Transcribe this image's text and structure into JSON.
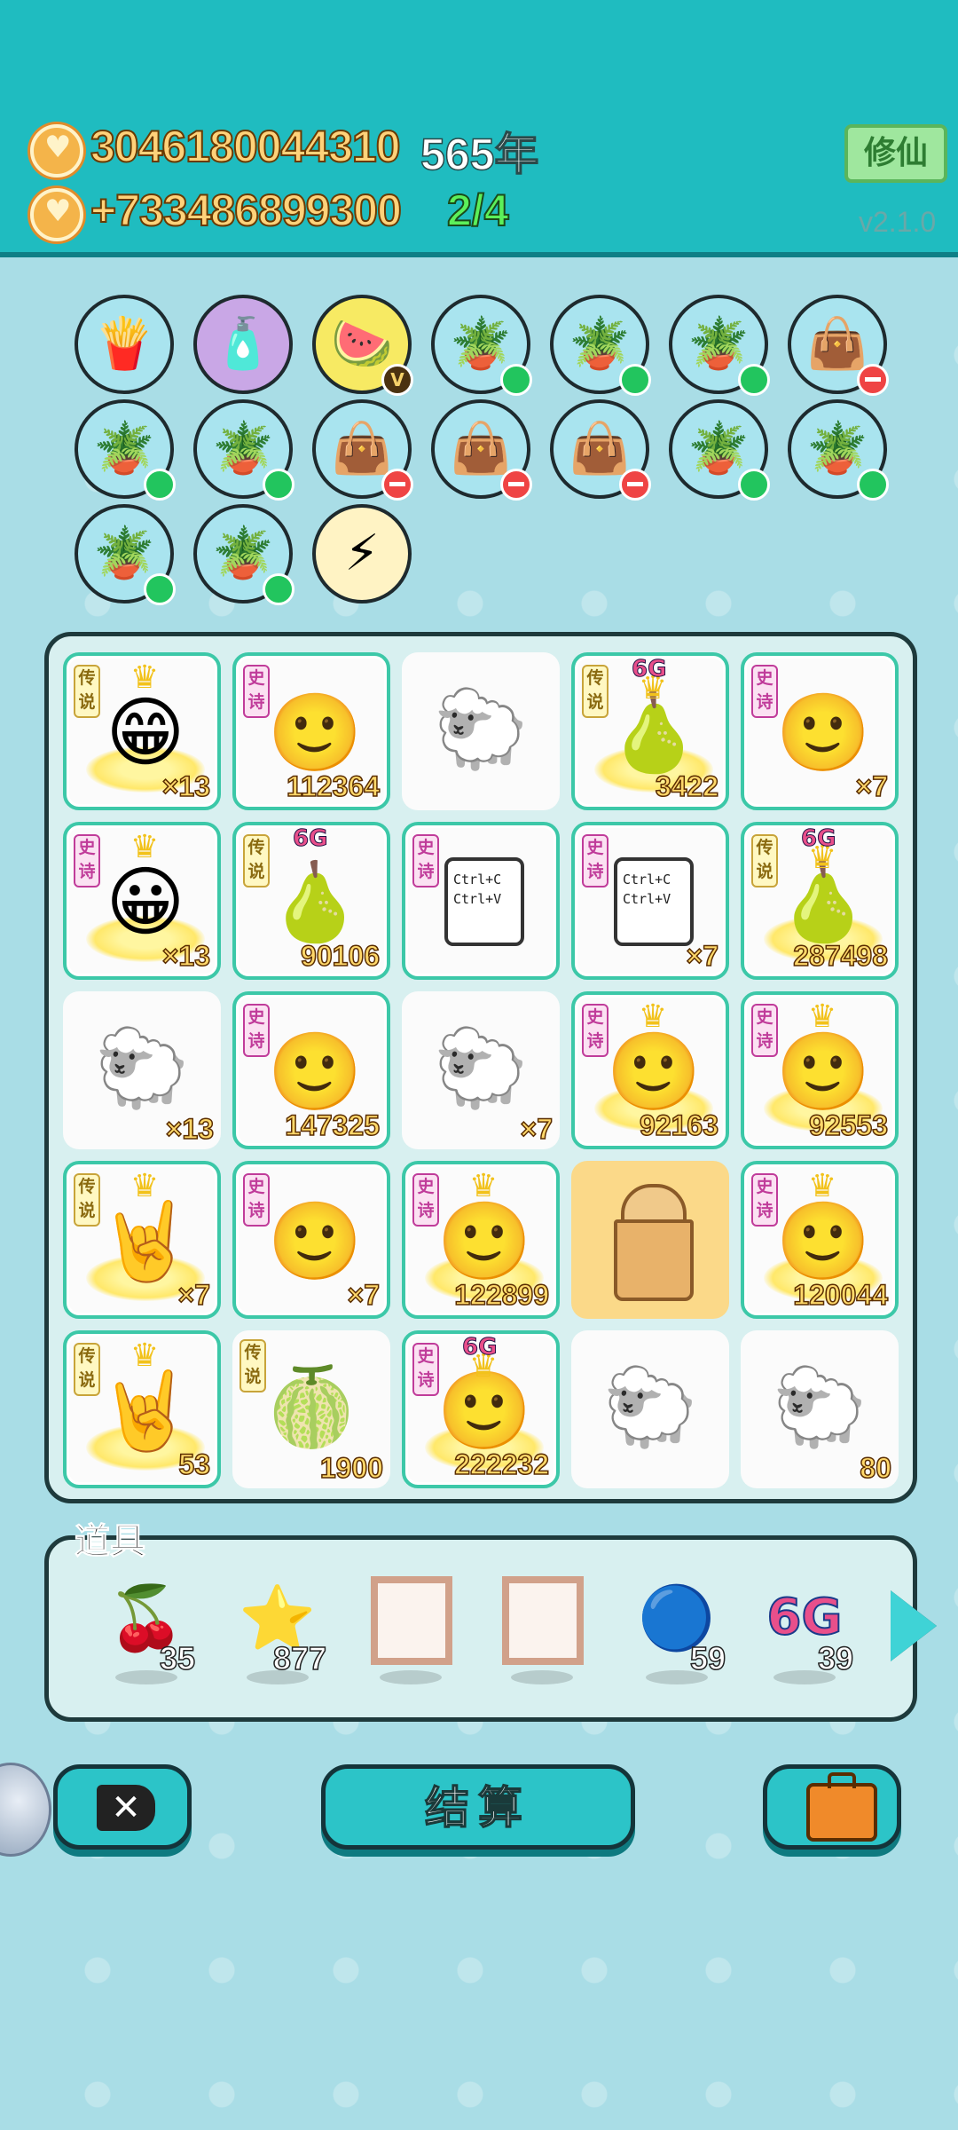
{
  "header": {
    "coins": "3046180044310",
    "years": "565年",
    "income": "+733486899300",
    "progress": "2/4",
    "cultivate_label": "修仙",
    "version": "v2.1.0"
  },
  "collection_row1": [
    {
      "icon": "fries-icon",
      "glyph": "🍟",
      "style": "",
      "badge": "none"
    },
    {
      "icon": "spray-bottle-icon",
      "glyph": "🧴",
      "style": "purple",
      "badge": "none"
    },
    {
      "icon": "fruit-basket-icon",
      "glyph": "🍉",
      "style": "yellow",
      "badge": "v",
      "badge_text": "V"
    },
    {
      "icon": "potted-flower-icon",
      "glyph": "🪴",
      "style": "",
      "badge": "green"
    },
    {
      "icon": "potted-flower-icon",
      "glyph": "🪴",
      "style": "",
      "badge": "green"
    },
    {
      "icon": "potted-flower-icon",
      "glyph": "🪴",
      "style": "",
      "badge": "green"
    },
    {
      "icon": "rice-sack-icon",
      "glyph": "👜",
      "style": "",
      "badge": "red"
    }
  ],
  "collection_row2": [
    {
      "icon": "potted-flower-icon",
      "glyph": "🪴",
      "style": "",
      "badge": "green"
    },
    {
      "icon": "potted-flower-icon",
      "glyph": "🪴",
      "style": "",
      "badge": "green"
    },
    {
      "icon": "rice-sack-icon",
      "glyph": "👜",
      "style": "",
      "badge": "red"
    },
    {
      "icon": "rice-sack-icon",
      "glyph": "👜",
      "style": "",
      "badge": "red"
    },
    {
      "icon": "rice-sack-icon",
      "glyph": "👜",
      "style": "",
      "badge": "red"
    },
    {
      "icon": "potted-flower-icon",
      "glyph": "🪴",
      "style": "",
      "badge": "green"
    },
    {
      "icon": "potted-flower-icon",
      "glyph": "🪴",
      "style": "",
      "badge": "green"
    }
  ],
  "collection_row3": [
    {
      "icon": "potted-flower-icon",
      "glyph": "🪴",
      "style": "",
      "badge": "green"
    },
    {
      "icon": "potted-flower-icon",
      "glyph": "🪴",
      "style": "",
      "badge": "green"
    },
    {
      "icon": "lightning-icon",
      "glyph": "⚡",
      "style": "bolt",
      "badge": "none"
    }
  ],
  "board": [
    [
      {
        "tag": "传说",
        "tag_type": "legend",
        "art": "bald-man-face-icon",
        "glyph": "😁",
        "crown": true,
        "sixg": false,
        "halo": true,
        "count": "×13"
      },
      {
        "tag": "史诗",
        "tag_type": "epic",
        "art": "man-face-icon",
        "glyph": "🙂",
        "crown": false,
        "sixg": false,
        "halo": false,
        "count": "112364"
      },
      {
        "tag": "",
        "tag_type": "",
        "art": "sheep-icon",
        "glyph": "🐑",
        "crown": false,
        "sixg": false,
        "halo": false,
        "count": "",
        "plain": true
      },
      {
        "tag": "传说",
        "tag_type": "legend",
        "art": "twin-fruit-icon",
        "glyph": "🍐",
        "crown": true,
        "sixg": true,
        "halo": true,
        "count": "3422"
      },
      {
        "tag": "史诗",
        "tag_type": "epic",
        "art": "man-face-icon",
        "glyph": "🙂",
        "crown": false,
        "sixg": false,
        "halo": false,
        "count": "×7"
      }
    ],
    [
      {
        "tag": "史诗",
        "tag_type": "epic",
        "art": "man-face-icon",
        "glyph": "😀",
        "crown": true,
        "sixg": false,
        "halo": true,
        "count": "×13"
      },
      {
        "tag": "传说",
        "tag_type": "legend",
        "art": "pear-icon",
        "glyph": "🍐",
        "crown": false,
        "sixg": true,
        "halo": false,
        "count": "90106"
      },
      {
        "tag": "史诗",
        "tag_type": "epic",
        "art": "ctrl-c-ctrl-v-icon",
        "clip": "Ctrl+C\nCtrl+V",
        "crown": false,
        "sixg": false,
        "halo": false,
        "count": ""
      },
      {
        "tag": "史诗",
        "tag_type": "epic",
        "art": "ctrl-c-ctrl-v-icon",
        "clip": "Ctrl+C\nCtrl+V",
        "crown": false,
        "sixg": false,
        "halo": false,
        "count": "×7"
      },
      {
        "tag": "传说",
        "tag_type": "legend",
        "art": "pear-icon",
        "glyph": "🍐",
        "crown": true,
        "sixg": true,
        "halo": true,
        "count": "287498"
      }
    ],
    [
      {
        "tag": "",
        "tag_type": "",
        "art": "sheep-icon",
        "glyph": "🐑",
        "crown": false,
        "sixg": false,
        "halo": false,
        "count": "×13",
        "plain": true
      },
      {
        "tag": "史诗",
        "tag_type": "epic",
        "art": "man-face-icon",
        "glyph": "🙂",
        "crown": false,
        "sixg": false,
        "halo": false,
        "count": "147325"
      },
      {
        "tag": "",
        "tag_type": "",
        "art": "sheep-icon",
        "glyph": "🐑",
        "crown": false,
        "sixg": false,
        "halo": false,
        "count": "×7",
        "plain": true
      },
      {
        "tag": "史诗",
        "tag_type": "epic",
        "art": "man-face-icon",
        "glyph": "🙂",
        "crown": true,
        "sixg": false,
        "halo": true,
        "count": "92163"
      },
      {
        "tag": "史诗",
        "tag_type": "epic",
        "art": "man-face-icon",
        "glyph": "🙂",
        "crown": true,
        "sixg": false,
        "halo": true,
        "count": "92553"
      }
    ],
    [
      {
        "tag": "传说",
        "tag_type": "legend",
        "art": "rock-hand-icon",
        "glyph": "🤘",
        "crown": true,
        "sixg": false,
        "halo": true,
        "count": "×7"
      },
      {
        "tag": "史诗",
        "tag_type": "epic",
        "art": "man-face-icon",
        "glyph": "🙂",
        "crown": false,
        "sixg": false,
        "halo": false,
        "count": "×7"
      },
      {
        "tag": "史诗",
        "tag_type": "epic",
        "art": "man-face-icon",
        "glyph": "🙂",
        "crown": true,
        "sixg": false,
        "halo": true,
        "count": "122899"
      },
      {
        "tag": "",
        "tag_type": "",
        "art": "bubble-tea-cup-icon",
        "cup": true,
        "crown": false,
        "sixg": false,
        "halo": false,
        "count": "",
        "empty": true
      },
      {
        "tag": "史诗",
        "tag_type": "epic",
        "art": "man-face-icon",
        "glyph": "🙂",
        "crown": true,
        "sixg": false,
        "halo": true,
        "count": "120044"
      }
    ],
    [
      {
        "tag": "传说",
        "tag_type": "legend",
        "art": "rock-hand-icon",
        "glyph": "🤘",
        "crown": true,
        "sixg": false,
        "halo": true,
        "count": "53"
      },
      {
        "tag": "传说",
        "tag_type": "legend",
        "art": "watermelon-icon",
        "glyph": "🍈",
        "crown": false,
        "sixg": false,
        "halo": false,
        "count": "1900",
        "plain": true
      },
      {
        "tag": "史诗",
        "tag_type": "epic",
        "art": "man-face-icon",
        "glyph": "🙂",
        "crown": true,
        "sixg": true,
        "halo": true,
        "count": "222232"
      },
      {
        "tag": "",
        "tag_type": "",
        "art": "sheep-icon",
        "glyph": "🐑",
        "crown": false,
        "sixg": false,
        "halo": false,
        "count": "",
        "plain": true
      },
      {
        "tag": "",
        "tag_type": "",
        "art": "sheep-icon",
        "glyph": "🐑",
        "crown": false,
        "sixg": false,
        "halo": false,
        "count": "80",
        "plain": true
      }
    ]
  ],
  "props": {
    "title": "道具",
    "items": [
      {
        "icon": "lychee-icon",
        "glyph": "🍒",
        "count": "35"
      },
      {
        "icon": "star-icon",
        "glyph": "⭐",
        "count": "877"
      },
      {
        "icon": "picture-frame-icon",
        "frame": true,
        "count": ""
      },
      {
        "icon": "picture-frame-icon",
        "frame": true,
        "count": ""
      },
      {
        "icon": "blueberry-icon",
        "glyph": "🔵",
        "count": "59"
      },
      {
        "icon": "sixg-icon",
        "sixg_text": "6G",
        "count": "39"
      }
    ]
  },
  "sixg_label": "6G",
  "crown_glyph": "♛",
  "buttons": {
    "exit_glyph": "✕",
    "settle_label": "结算"
  }
}
